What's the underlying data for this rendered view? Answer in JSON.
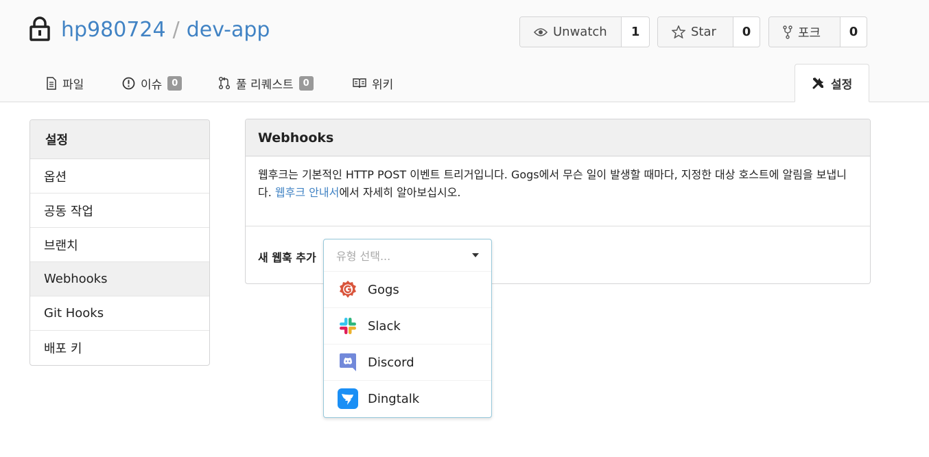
{
  "repo": {
    "owner": "hp980724",
    "separator": "/",
    "name": "dev-app"
  },
  "header_buttons": [
    {
      "label": "Unwatch",
      "icon": "eye-icon",
      "count": "1"
    },
    {
      "label": "Star",
      "icon": "star-icon",
      "count": "0"
    },
    {
      "label": "포크",
      "icon": "fork-icon",
      "count": "0"
    }
  ],
  "tabs": [
    {
      "label": "파일",
      "icon": "file-icon"
    },
    {
      "label": "이슈",
      "icon": "issue-icon",
      "badge": "0"
    },
    {
      "label": "풀 리퀘스트",
      "icon": "pull-request-icon",
      "badge": "0"
    },
    {
      "label": "위키",
      "icon": "book-icon"
    },
    {
      "label": "설정",
      "icon": "tools-icon",
      "active": true
    }
  ],
  "sidebar": {
    "title": "설정",
    "items": [
      {
        "label": "옵션"
      },
      {
        "label": "공동 작업"
      },
      {
        "label": "브랜치"
      },
      {
        "label": "Webhooks",
        "active": true
      },
      {
        "label": "Git Hooks"
      },
      {
        "label": "배포 키"
      }
    ]
  },
  "panel": {
    "title": "Webhooks",
    "desc_before": "웹후크는 기본적인 HTTP POST 이벤트 트리거입니다. Gogs에서 무슨 일이 발생할 때마다, 지정한 대상 호스트에 알림을 보냅니다. ",
    "desc_link": "웹후크 안내서",
    "desc_after": "에서 자세히 알아보십시오.",
    "add_label": "새 웹훅 추가"
  },
  "dropdown": {
    "placeholder": "유형 선택...",
    "options": [
      {
        "label": "Gogs",
        "icon": "gogs-icon"
      },
      {
        "label": "Slack",
        "icon": "slack-icon"
      },
      {
        "label": "Discord",
        "icon": "discord-icon"
      },
      {
        "label": "Dingtalk",
        "icon": "dingtalk-icon"
      }
    ]
  },
  "colors": {
    "link": "#4183c4",
    "gogs": "#d9553c",
    "discord": "#7289da",
    "dingtalk": "#1a8ff5"
  }
}
